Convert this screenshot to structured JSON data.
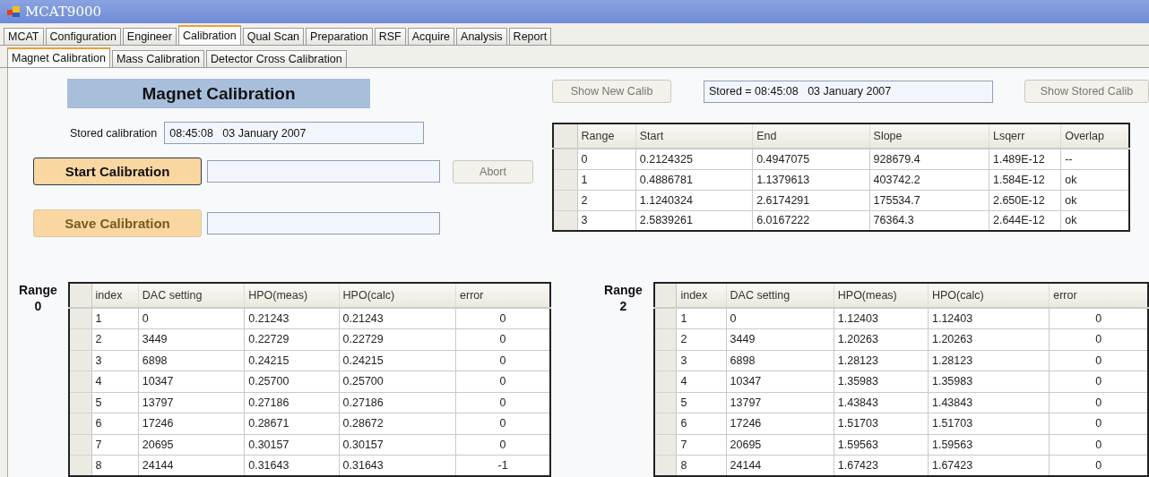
{
  "window": {
    "title": "MCAT9000"
  },
  "tabs": [
    {
      "label": "MCAT",
      "selected": false
    },
    {
      "label": "Configuration",
      "selected": false
    },
    {
      "label": "Engineer",
      "selected": false
    },
    {
      "label": "Calibration",
      "selected": true
    },
    {
      "label": "Qual Scan",
      "selected": false
    },
    {
      "label": "Preparation",
      "selected": false
    },
    {
      "label": "RSF",
      "selected": false
    },
    {
      "label": "Acquire",
      "selected": false
    },
    {
      "label": "Analysis",
      "selected": false
    },
    {
      "label": "Report",
      "selected": false
    }
  ],
  "subtabs": [
    {
      "label": "Magnet Calibration",
      "selected": true
    },
    {
      "label": "Mass Calibration",
      "selected": false
    },
    {
      "label": "Detector Cross Calibration",
      "selected": false
    }
  ],
  "banner": "Magnet Calibration",
  "stored_calibration": {
    "label": "Stored calibration",
    "value": "08:45:08   03 January 2007"
  },
  "start_button": {
    "label": "Start Calibration",
    "disabled": false
  },
  "abort_button": {
    "label": "Abort",
    "disabled": true
  },
  "save_button": {
    "label": "Save Calibration",
    "disabled": true
  },
  "show_new_button": {
    "label": "Show New Calib",
    "disabled": true
  },
  "stored_field": {
    "value": "Stored = 08:45:08   03 January 2007"
  },
  "show_stored_button": {
    "label": "Show Stored Calib",
    "disabled": true
  },
  "summary_table": {
    "columns": [
      "Range",
      "Start",
      "End",
      "Slope",
      "Lsqerr",
      "Overlap"
    ],
    "rows": [
      [
        "0",
        "0.2124325",
        "0.4947075",
        "928679.4",
        "1.489E-12",
        "--"
      ],
      [
        "1",
        "0.4886781",
        "1.1379613",
        "403742.2",
        "1.584E-12",
        "ok"
      ],
      [
        "2",
        "1.1240324",
        "2.6174291",
        "175534.7",
        "2.650E-12",
        "ok"
      ],
      [
        "3",
        "2.5839261",
        "6.0167222",
        "76364.3",
        "2.644E-12",
        "ok"
      ]
    ]
  },
  "range_tables": [
    {
      "label": "Range",
      "number": "0",
      "columns": [
        "index",
        "DAC setting",
        "HPO(meas)",
        "HPO(calc)",
        "error"
      ],
      "rows": [
        [
          "1",
          "0",
          "0.21243",
          "0.21243",
          "0"
        ],
        [
          "2",
          "3449",
          "0.22729",
          "0.22729",
          "0"
        ],
        [
          "3",
          "6898",
          "0.24215",
          "0.24215",
          "0"
        ],
        [
          "4",
          "10347",
          "0.25700",
          "0.25700",
          "0"
        ],
        [
          "5",
          "13797",
          "0.27186",
          "0.27186",
          "0"
        ],
        [
          "6",
          "17246",
          "0.28671",
          "0.28672",
          "0"
        ],
        [
          "7",
          "20695",
          "0.30157",
          "0.30157",
          "0"
        ],
        [
          "8",
          "24144",
          "0.31643",
          "0.31643",
          "-1"
        ]
      ]
    },
    {
      "label": "Range",
      "number": "2",
      "columns": [
        "index",
        "DAC setting",
        "HPO(meas)",
        "HPO(calc)",
        "error"
      ],
      "rows": [
        [
          "1",
          "0",
          "1.12403",
          "1.12403",
          "0"
        ],
        [
          "2",
          "3449",
          "1.20263",
          "1.20263",
          "0"
        ],
        [
          "3",
          "6898",
          "1.28123",
          "1.28123",
          "0"
        ],
        [
          "4",
          "10347",
          "1.35983",
          "1.35983",
          "0"
        ],
        [
          "5",
          "13797",
          "1.43843",
          "1.43843",
          "0"
        ],
        [
          "6",
          "17246",
          "1.51703",
          "1.51703",
          "0"
        ],
        [
          "7",
          "20695",
          "1.59563",
          "1.59563",
          "0"
        ],
        [
          "8",
          "24144",
          "1.67423",
          "1.67423",
          "0"
        ]
      ]
    }
  ]
}
